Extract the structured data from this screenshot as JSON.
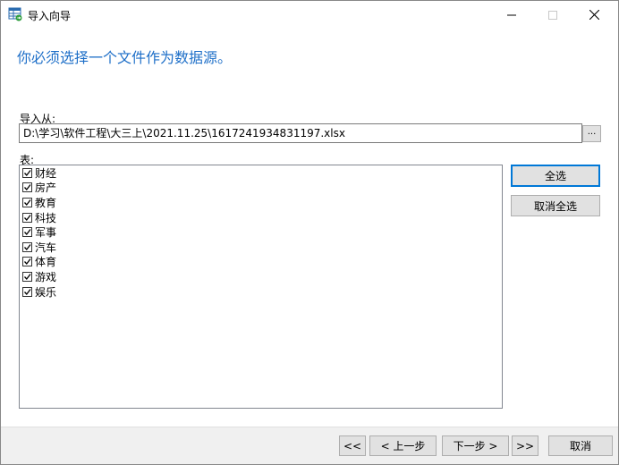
{
  "window": {
    "title": "导入向导",
    "icon": "table-import-icon"
  },
  "heading": "你必须选择一个文件作为数据源。",
  "import_from": {
    "label": "导入从:",
    "path": "D:\\学习\\软件工程\\大三上\\2021.11.25\\1617241934831197.xlsx",
    "browse_label": "..."
  },
  "tables": {
    "label": "表:",
    "items": [
      {
        "label": "财经",
        "checked": true
      },
      {
        "label": "房产",
        "checked": true
      },
      {
        "label": "教育",
        "checked": true
      },
      {
        "label": "科技",
        "checked": true
      },
      {
        "label": "军事",
        "checked": true
      },
      {
        "label": "汽车",
        "checked": true
      },
      {
        "label": "体育",
        "checked": true
      },
      {
        "label": "游戏",
        "checked": true
      },
      {
        "label": "娱乐",
        "checked": true
      }
    ]
  },
  "buttons": {
    "select_all": "全选",
    "deselect_all": "取消全选"
  },
  "footer": {
    "first": "<<",
    "prev": "< 上一步",
    "next": "下一步 >",
    "last": ">>",
    "cancel": "取消"
  },
  "colors": {
    "heading": "#1e6fc8",
    "focus_border": "#0078d7",
    "button_bg": "#e1e1e1",
    "footer_bg": "#f0f0f0"
  }
}
